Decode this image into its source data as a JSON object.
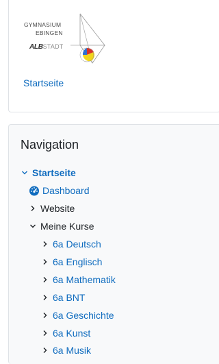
{
  "logo_block": {
    "logo_line1": "GYMNASIUM",
    "logo_line2": "EBINGEN",
    "logo_alb": "ALB",
    "logo_stadt": "STADT",
    "home_link": "Startseite"
  },
  "navigation": {
    "title": "Navigation",
    "items": [
      {
        "label": "Startseite",
        "expanded": true,
        "icon": "chevron-down-icon"
      },
      {
        "label": "Dashboard",
        "icon": "dashboard-icon"
      },
      {
        "label": "Website",
        "expanded": false,
        "icon": "chevron-right-icon"
      },
      {
        "label": "Meine Kurse",
        "expanded": true,
        "icon": "chevron-down-icon"
      },
      {
        "label": "6a Deutsch",
        "icon": "chevron-right-icon"
      },
      {
        "label": "6a Englisch",
        "icon": "chevron-right-icon"
      },
      {
        "label": "6a Mathematik",
        "icon": "chevron-right-icon"
      },
      {
        "label": "6a BNT",
        "icon": "chevron-right-icon"
      },
      {
        "label": "6a Geschichte",
        "icon": "chevron-right-icon"
      },
      {
        "label": "6a Kunst",
        "icon": "chevron-right-icon"
      },
      {
        "label": "6a Musik",
        "icon": "chevron-right-icon"
      }
    ]
  },
  "colors": {
    "link": "#0f6cbf",
    "text": "#1d2125",
    "panel_bg": "#f8f9fa",
    "border": "#dee2e6"
  }
}
